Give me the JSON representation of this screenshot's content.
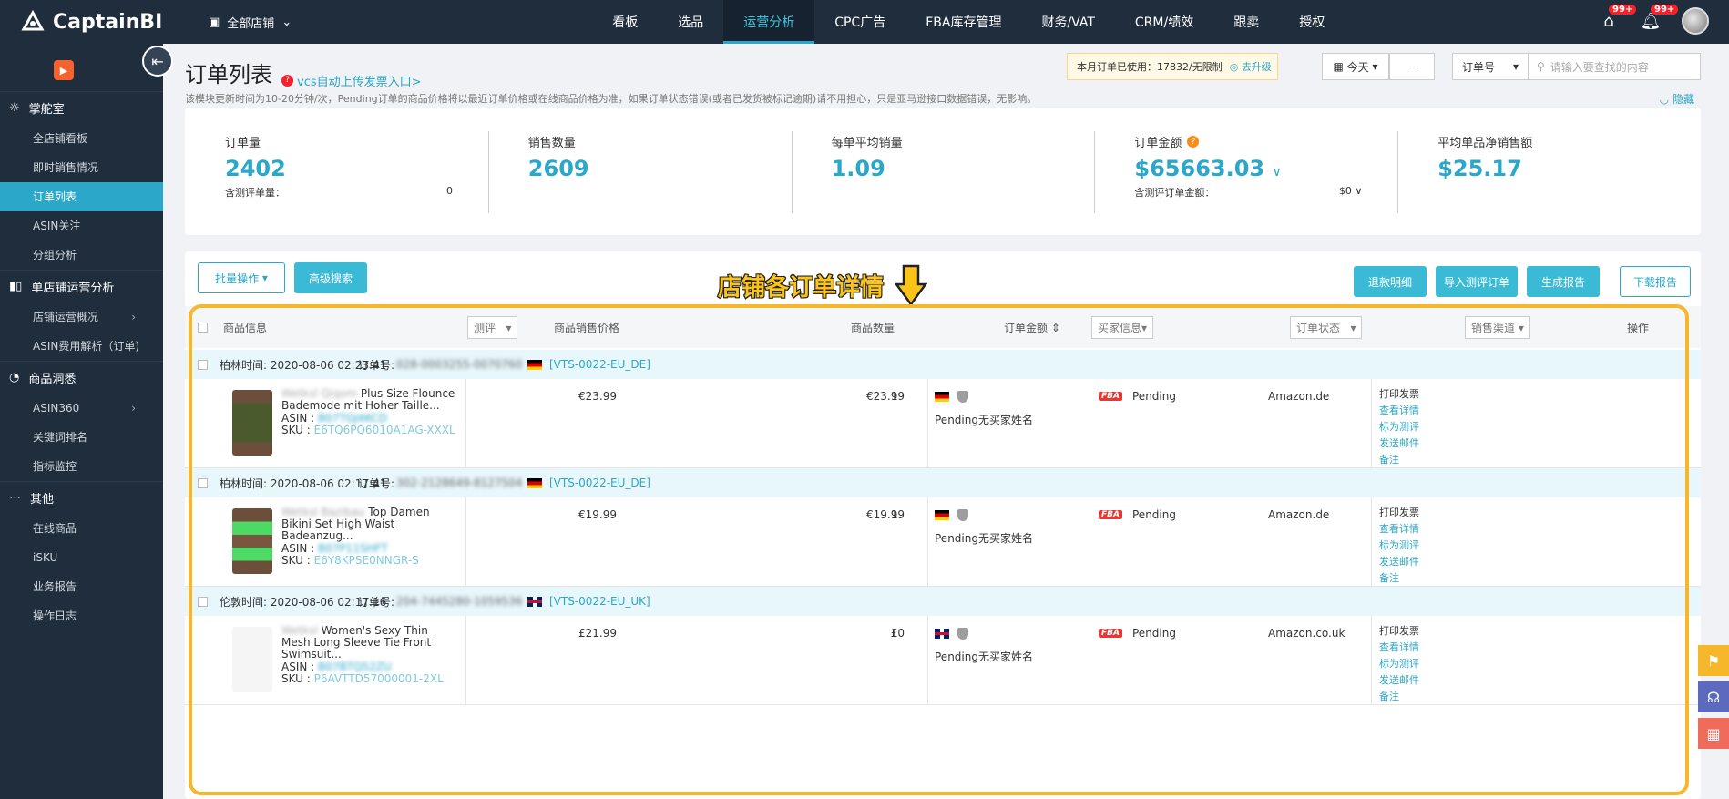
{
  "app": {
    "logo_text": "CaptainBI",
    "store_selector": "全部店铺"
  },
  "nav": [
    "看板",
    "选品",
    "运营分析",
    "CPC广告",
    "FBA库存管理",
    "财务/VAT",
    "CRM/绩效",
    "跟卖",
    "授权"
  ],
  "nav_active_index": 2,
  "badges": {
    "notice1": "99+",
    "notice2": "99+"
  },
  "sidebar": {
    "sections": [
      {
        "title": "掌舵室",
        "icon": "gear-icon",
        "items": [
          "全店铺看板",
          "即时销售情况",
          "订单列表",
          "ASIN关注",
          "分组分析"
        ]
      },
      {
        "title": "单店铺运营分析",
        "icon": "bar-chart-icon",
        "items": [
          "店铺运营概况",
          "ASIN费用解析（订单)"
        ]
      },
      {
        "title": "商品洞悉",
        "icon": "pie-chart-icon",
        "items": [
          "ASIN360",
          "关键词排名",
          "指标监控"
        ]
      },
      {
        "title": "其他",
        "icon": "more-icon",
        "items": [
          "在线商品",
          "iSKU",
          "业务报告",
          "操作日志"
        ]
      }
    ],
    "active_item": "订单列表"
  },
  "page": {
    "title": "订单列表",
    "vcs_link": "vcs自动上传发票入口>",
    "notice": "该模块更新时间为10-20分钟/次，Pending订单的商品价格将以最近订单价格或在线商品价格为准，如果订单状态错误(或者已发货被标记逾期)请不用担心，只是亚马逊接口数据错误，无影响。",
    "hide_label": "隐藏",
    "quota_text": "本月订单已使用：17832/无限制",
    "quota_upgrade": "去升级",
    "date_label": "今天",
    "search_type": "订单号",
    "search_placeholder": "请输入要查找的内容"
  },
  "stats": {
    "orders": {
      "label": "订单量",
      "value": "2402",
      "sub_label": "含测评单量：",
      "sub_value": "0"
    },
    "qty": {
      "label": "销售数量",
      "value": "2609"
    },
    "avg": {
      "label": "每单平均销量",
      "value": "1.09"
    },
    "amount": {
      "label": "订单金额",
      "value": "$65663.03",
      "sub_label": "含测评订单金额：",
      "sub_value": "$0"
    },
    "net": {
      "label": "平均单品净销售额",
      "value": "$25.17"
    }
  },
  "toolbar": {
    "bulk": "批量操作",
    "advanced": "高级搜索",
    "refund": "退款明细",
    "import": "导入测评订单",
    "report": "生成报告",
    "download": "下载报告"
  },
  "annotation": "店铺各订单详情",
  "table_headers": {
    "product": "商品信息",
    "review": "测评",
    "price": "商品销售价格",
    "qty": "商品数量",
    "amount": "订单金额",
    "buyer": "买家信息",
    "status": "订单状态",
    "channel": "销售渠道",
    "ops": "操作"
  },
  "orders": [
    {
      "time": "柏林时间: 2020-08-06 02:23:41",
      "order_no_label": "订单号:",
      "order_no": "028-0003255-0070760",
      "store": "[VTS-0022-EU_DE]",
      "title_blur": "Wetksl Qiqom",
      "title": "Plus Size Flounce Bademode mit Hoher Taille...",
      "asin": "B07TGJ4KCD",
      "sku": "E6TQ6PQ6010A1AG-XXXL",
      "price": "€23.99",
      "qty": "1",
      "amount": "€23.99",
      "buyer": "Pending无买家姓名",
      "status": "Pending",
      "channel": "Amazon.de",
      "actions": [
        "打印发票",
        "查看详情",
        "标为测评",
        "发送邮件",
        "备注"
      ]
    },
    {
      "time": "柏林时间: 2020-08-06 02:17:41",
      "order_no_label": "订单号:",
      "order_no": "302-2128649-8127504",
      "store": "[VTS-0022-EU_DE]",
      "title_blur": "Wetksl Bazibau",
      "title": "Top Damen Bikini Set High Waist Badeanzug...",
      "asin": "B07P11SHFT",
      "sku": "E6Y8KPSE0NNGR-S",
      "price": "€19.99",
      "qty": "1",
      "amount": "€19.99",
      "buyer": "Pending无买家姓名",
      "status": "Pending",
      "channel": "Amazon.de",
      "actions": [
        "打印发票",
        "查看详情",
        "标为测评",
        "发送邮件",
        "备注"
      ]
    },
    {
      "time": "伦敦时间: 2020-08-06 02:17:16",
      "order_no_label": "订单号:",
      "order_no": "204-7445280-1059536",
      "store": "[VTS-0022-EU_UK]",
      "title_blur": "Wetksl",
      "title": "Women's Sexy Thin Mesh Long Sleeve Tie Front Swimsuit...",
      "asin": "B07BTQ52ZU",
      "sku": "P6AVTTD57000001-2XL",
      "price": "£21.99",
      "qty": "1",
      "amount": "£0",
      "buyer": "Pending无买家姓名",
      "status": "Pending",
      "channel": "Amazon.co.uk",
      "actions": [
        "打印发票",
        "查看详情",
        "标为测评",
        "发送邮件",
        "备注"
      ]
    }
  ],
  "colors": {
    "accent": "#2aa7c9",
    "highlight": "#f7b72a",
    "sidebar": "#1f2d3d"
  }
}
